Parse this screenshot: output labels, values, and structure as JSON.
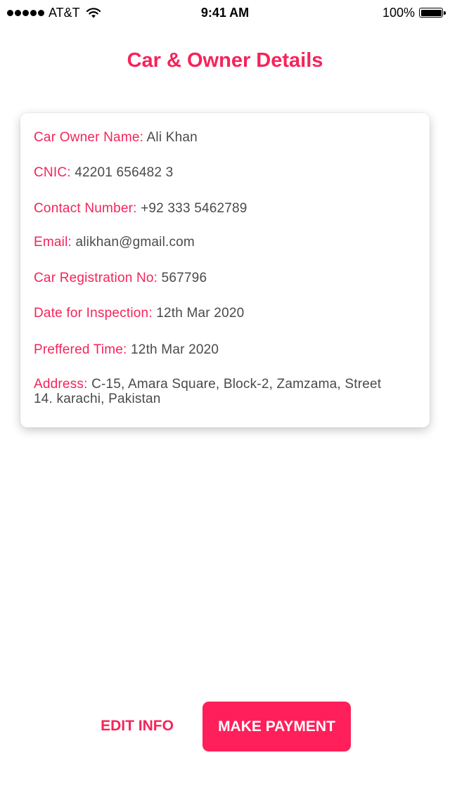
{
  "status_bar": {
    "carrier": "AT&T",
    "time": "9:41 AM",
    "battery_percent": "100%"
  },
  "title": "Car & Owner Details",
  "details": {
    "owner_name": {
      "label": "Car Owner Name:",
      "value": "Ali Khan"
    },
    "cnic": {
      "label": "CNIC:",
      "value": "42201 656482 3"
    },
    "contact": {
      "label": "Contact Number:",
      "value": "+92 333 5462789"
    },
    "email": {
      "label": "Email:",
      "value": "alikhan@gmail.com"
    },
    "registration": {
      "label": "Car Registration No:",
      "value": "567796"
    },
    "inspection_date": {
      "label": "Date for Inspection:",
      "value": "12th Mar 2020"
    },
    "preferred_time": {
      "label": "Preffered Time:",
      "value": "12th Mar 2020"
    },
    "address": {
      "label": "Address:",
      "value": "C-15, Amara Square, Block-2, Zamzama, Street 14. karachi, Pakistan"
    }
  },
  "actions": {
    "edit_label": "EDIT INFO",
    "payment_label": "MAKE PAYMENT"
  },
  "colors": {
    "accent": "#f5245a",
    "button_bg": "#ff1f5a",
    "value_text": "#4a4a4a"
  }
}
